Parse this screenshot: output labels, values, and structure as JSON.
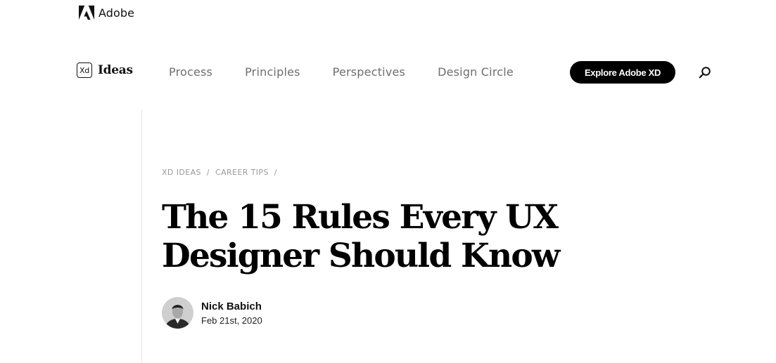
{
  "top_bar": {
    "brand_label": "Adobe",
    "logo_icon": "adobe-logo-icon"
  },
  "nav": {
    "xd_badge": "Xd",
    "brand_label": "Ideas",
    "links": [
      "Process",
      "Principles",
      "Perspectives",
      "Design Circle"
    ],
    "cta_label": "Explore Adobe XD",
    "search_icon": "search-icon"
  },
  "article": {
    "breadcrumb": [
      "XD IDEAS",
      "CAREER TIPS"
    ],
    "breadcrumb_separator": "/",
    "title_line1": "The 15 Rules Every UX",
    "title_line2": "Designer Should Know",
    "author": {
      "name": "Nick Babich",
      "date": "Feb 21st, 2020"
    }
  },
  "colors": {
    "accent": "#000000",
    "nav_text": "#6e6e6e",
    "breadcrumb_text": "#9a9a9a",
    "divider": "#e6e6e6"
  }
}
